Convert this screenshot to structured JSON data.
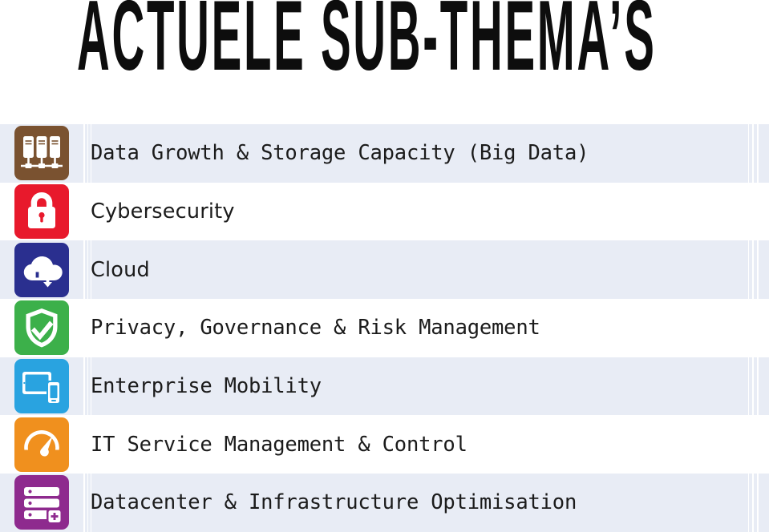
{
  "slide": {
    "title": "ACTUELE SUB-THEMA’S"
  },
  "table": {
    "band_color": "#e8ecf5",
    "rows": [
      {
        "label": "Data Growth & Storage Capacity (Big Data)",
        "icon": "servers-icon",
        "icon_color": "#7a5230",
        "banded": true,
        "label_style": "mono"
      },
      {
        "label": "Cybersecurity",
        "icon": "padlock-icon",
        "icon_color": "#e8192c",
        "banded": false,
        "label_style": "narrow"
      },
      {
        "label": "Cloud",
        "icon": "cloud-upload-download-icon",
        "icon_color": "#2a2f8f",
        "banded": true,
        "label_style": "narrow"
      },
      {
        "label": "Privacy, Governance & Risk Management",
        "icon": "shield-check-icon",
        "icon_color": "#3cb04a",
        "banded": false,
        "label_style": "mono"
      },
      {
        "label": "Enterprise Mobility",
        "icon": "tablet-phone-icon",
        "icon_color": "#29a3e0",
        "banded": true,
        "label_style": "mono"
      },
      {
        "label": "IT Service Management & Control",
        "icon": "gauge-icon",
        "icon_color": "#f0901e",
        "banded": false,
        "label_style": "mono"
      },
      {
        "label": "Datacenter & Infrastructure Optimisation",
        "icon": "datacenter-add-icon",
        "icon_color": "#8e2a8e",
        "banded": true,
        "label_style": "mono"
      }
    ]
  }
}
